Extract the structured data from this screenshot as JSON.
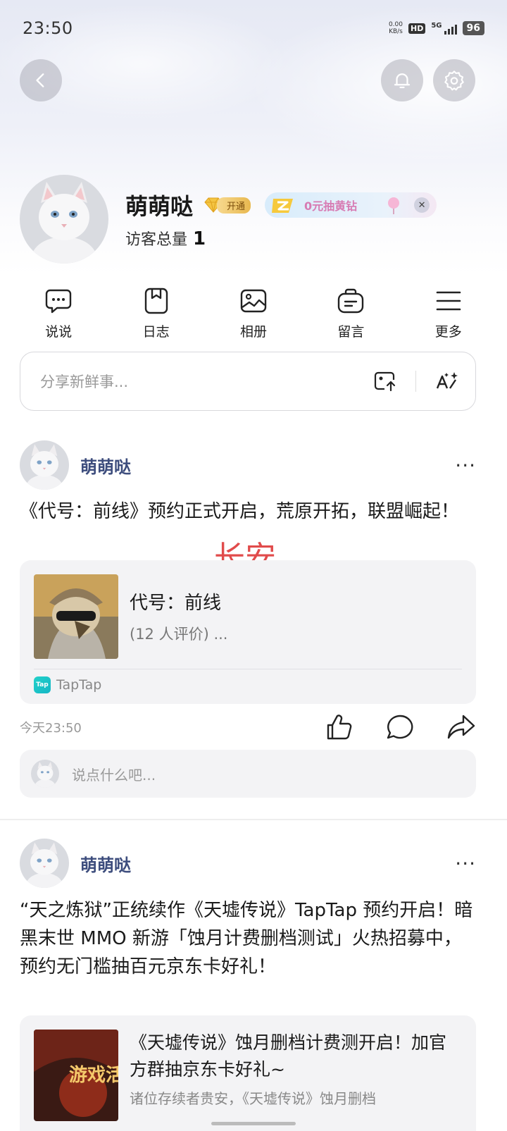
{
  "status_bar": {
    "time": "23:50",
    "net_speed_value": "0.00",
    "net_speed_unit": "KB/s",
    "hd": "HD",
    "network": "5G",
    "battery": "96"
  },
  "profile": {
    "username": "萌萌哒",
    "vip_label": "开通",
    "promo_text": "0元抽黄钻",
    "visits_label": "访客总量",
    "visits_count": "1"
  },
  "quick_nav": [
    {
      "label": "说说",
      "icon": "chat-bubble-icon"
    },
    {
      "label": "日志",
      "icon": "bookmark-icon"
    },
    {
      "label": "相册",
      "icon": "image-icon"
    },
    {
      "label": "留言",
      "icon": "message-bag-icon"
    },
    {
      "label": "更多",
      "icon": "menu-icon"
    }
  ],
  "share": {
    "placeholder": "分享新鲜事..."
  },
  "posts": [
    {
      "author": "萌萌哒",
      "text": "《代号：前线》预约正式开启，荒原开拓，联盟崛起！",
      "card": {
        "title": "代号：前线",
        "rating": "(12 人评价)  ...",
        "source": "TapTap",
        "source_logo_text": "Tap"
      },
      "time": "今天23:50",
      "comment_placeholder": "说点什么吧..."
    },
    {
      "author": "萌萌哒",
      "text": "“天之炼狱”正统续作《天墟传说》TapTap 预约开启！暗黑末世 MMO 新游「蚀月计费删档测试」火热招募中，预约无门槛抽百元京东卡好礼！",
      "card": {
        "title": "《天墟传说》蚀月删档计费测开启！加官方群抽京东卡好礼~",
        "snippet": "诸位存续者贵安，《天墟传说》蚀月删档",
        "thumb_text": "游戏活"
      }
    }
  ],
  "watermark": "长安",
  "colors": {
    "author_name": "#3d4d7d",
    "watermark": "#e14b4b",
    "promo_text": "#d77bb3"
  }
}
